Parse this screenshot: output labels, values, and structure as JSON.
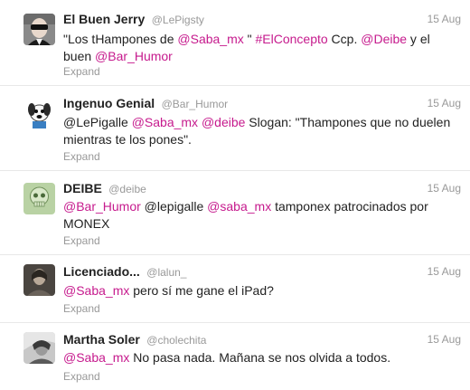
{
  "tweets": [
    {
      "fullname": "El Buen Jerry",
      "username": "@LePigsty",
      "time": "15 Aug",
      "avatar_icon": "man-in-dark-glasses-avatar",
      "segments": [
        {
          "text": "\"Los tHampones de ",
          "type": "plain"
        },
        {
          "text": "@Saba_mx",
          "type": "mention"
        },
        {
          "text": " \" ",
          "type": "plain"
        },
        {
          "text": "#ElConcepto",
          "type": "tag"
        },
        {
          "text": " Ccp. ",
          "type": "plain"
        },
        {
          "text": "@Deibe",
          "type": "mention"
        },
        {
          "text": " y el buen ",
          "type": "plain"
        },
        {
          "text": "@Bar_Humor",
          "type": "mention"
        }
      ],
      "expand_label": "Expand"
    },
    {
      "fullname": "Ingenuo Genial",
      "username": "@Bar_Humor",
      "time": "15 Aug",
      "avatar_icon": "cartoon-dog-avatar",
      "segments": [
        {
          "text": "@LePigalle ",
          "type": "plain"
        },
        {
          "text": "@Saba_mx",
          "type": "mention"
        },
        {
          "text": " ",
          "type": "plain"
        },
        {
          "text": "@deibe",
          "type": "mention"
        },
        {
          "text": " Slogan: \"Thampones que no duelen mientras te los pones\".",
          "type": "plain"
        }
      ],
      "expand_label": "Expand"
    },
    {
      "fullname": "DEIBE",
      "username": "@deibe",
      "time": "15 Aug",
      "avatar_icon": "green-skull-avatar",
      "segments": [
        {
          "text": "@Bar_Humor",
          "type": "mention"
        },
        {
          "text": " @lepigalle ",
          "type": "plain"
        },
        {
          "text": "@saba_mx",
          "type": "mention"
        },
        {
          "text": " tamponex patrocinados por MONEX",
          "type": "plain"
        }
      ],
      "expand_label": "Expand"
    },
    {
      "fullname": "Licenciado...",
      "username": "@lalun_",
      "time": "15 Aug",
      "avatar_icon": "portrait-photo-avatar",
      "segments": [
        {
          "text": "@Saba_mx",
          "type": "mention"
        },
        {
          "text": " pero sí me gane el iPad?",
          "type": "plain"
        }
      ],
      "expand_label": "Expand"
    },
    {
      "fullname": "Martha Soler",
      "username": "@cholechita",
      "time": "15 Aug",
      "avatar_icon": "woman-photo-avatar",
      "segments": [
        {
          "text": "@Saba_mx",
          "type": "mention"
        },
        {
          "text": " No pasa nada. Mañana se nos olvida a todos.",
          "type": "plain"
        }
      ],
      "expand_label": "Expand"
    }
  ],
  "colors": {
    "mention": "#c61a8d",
    "muted": "#999999",
    "text": "#222222",
    "divider": "#e8e8e8"
  }
}
